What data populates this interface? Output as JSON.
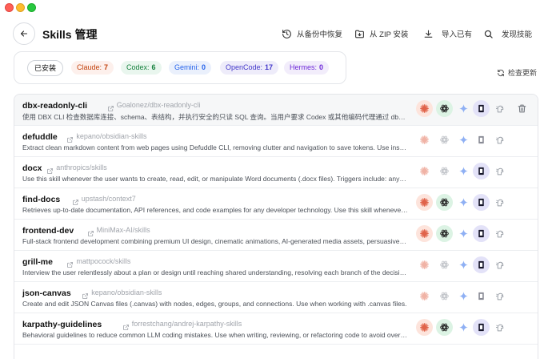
{
  "header": {
    "title": "Skills 管理",
    "actions": {
      "restore": "从备份中恢复",
      "zip_install": "从 ZIP 安装",
      "import": "导入已有",
      "discover": "发现技能"
    }
  },
  "stats": {
    "installed_label": "已安装",
    "pills": {
      "claude": {
        "label": "Claude:",
        "count": "7"
      },
      "codex": {
        "label": "Codex:",
        "count": "6"
      },
      "gemini": {
        "label": "Gemini:",
        "count": "0"
      },
      "opencode": {
        "label": "OpenCode:",
        "count": "17"
      },
      "hermes": {
        "label": "Hermes:",
        "count": "0"
      }
    }
  },
  "refresh_label": "检查更新",
  "colors": {
    "claude": "#e0634a",
    "codex": "#222222",
    "gemini": "#6a8ff0",
    "opencode": "#1a1a2e",
    "accent_bg_claude": "#fde4dc",
    "accent_bg_codex": "#dcf3e4",
    "accent_bg_opencode": "#e3e2f8"
  },
  "icons": {
    "claude": "claude-starburst-icon",
    "codex": "openai-knot-icon",
    "gemini": "gemini-sparkle-icon",
    "opencode": "opencode-square-icon",
    "hermes": "hermes-helmet-icon",
    "trash": "trash-icon",
    "link": "external-link-icon"
  },
  "skills": [
    {
      "name": "dbx-readonly-cli",
      "source": "Goalonez/dbx-readonly-cli",
      "description": "使用 DBX CLI 检查数据库连接、schema、表结构，并执行安全的只读 SQL 查询。当用户要求 Codex 或其他编码代理通过 dbx 命令检查数据库、查看表结构或运行只读查询时使用。",
      "claude": true,
      "codex": true,
      "gemini": false,
      "opencode": true,
      "hermes": false,
      "selected": true
    },
    {
      "name": "defuddle",
      "source": "kepano/obsidian-skills",
      "description": "Extract clean markdown content from web pages using Defuddle CLI, removing clutter and navigation to save tokens. Use instead of WebFetch when the user provides a URL.",
      "claude": false,
      "codex": false,
      "gemini": false,
      "opencode": false,
      "hermes": false,
      "selected": false
    },
    {
      "name": "docx",
      "source": "anthropics/skills",
      "description": "Use this skill whenever the user wants to create, read, edit, or manipulate Word documents (.docx files). Triggers include: any mention of Word doc or .docx",
      "claude": false,
      "codex": false,
      "gemini": false,
      "opencode": true,
      "hermes": false,
      "selected": false
    },
    {
      "name": "find-docs",
      "source": "upstash/context7",
      "description": "Retrieves up-to-date documentation, API references, and code examples for any developer technology. Use this skill whenever the user asks about a library.",
      "claude": true,
      "codex": true,
      "gemini": false,
      "opencode": true,
      "hermes": false,
      "selected": false
    },
    {
      "name": "frontend-dev",
      "source": "MiniMax-AI/skills",
      "description": "Full-stack frontend development combining premium UI design, cinematic animations, AI-generated media assets, persuasive copywriting and more.",
      "claude": true,
      "codex": true,
      "gemini": false,
      "opencode": true,
      "hermes": false,
      "selected": false
    },
    {
      "name": "grill-me",
      "source": "mattpocock/skills",
      "description": "Interview the user relentlessly about a plan or design until reaching shared understanding, resolving each branch of the decision tree.",
      "claude": false,
      "codex": false,
      "gemini": false,
      "opencode": true,
      "hermes": false,
      "selected": false
    },
    {
      "name": "json-canvas",
      "source": "kepano/obsidian-skills",
      "description": "Create and edit JSON Canvas files (.canvas) with nodes, edges, groups, and connections. Use when working with .canvas files.",
      "claude": false,
      "codex": false,
      "gemini": false,
      "opencode": false,
      "hermes": false,
      "selected": false
    },
    {
      "name": "karpathy-guidelines",
      "source": "forrestchang/andrej-karpathy-skills",
      "description": "Behavioral guidelines to reduce common LLM coding mistakes. Use when writing, reviewing, or refactoring code to avoid overcomplication.",
      "claude": true,
      "codex": true,
      "gemini": false,
      "opencode": true,
      "hermes": false,
      "selected": false
    }
  ]
}
